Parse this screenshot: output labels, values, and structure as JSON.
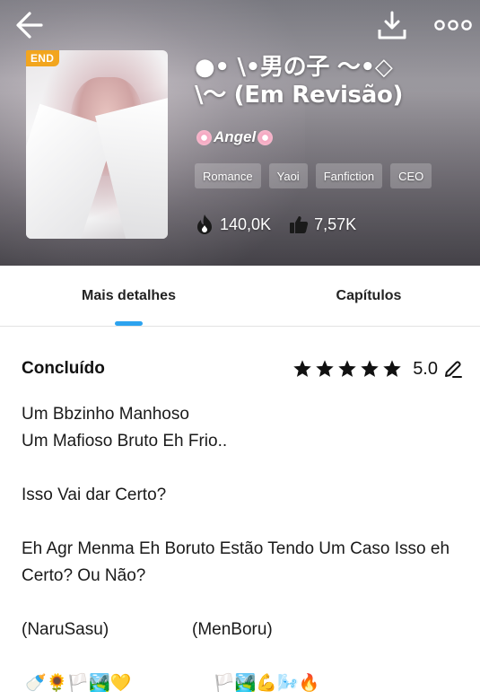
{
  "header": {
    "end_badge": "END",
    "title": "●• \\•男の子 〜•◇\n\\〜 (Em Revisão)",
    "author": "Angel",
    "tags": [
      "Romance",
      "Yaoi",
      "Fanfiction",
      "CEO"
    ],
    "views": "140,0K",
    "likes": "7,57K",
    "icons": {
      "back": "arrow-left-icon",
      "download": "download-icon",
      "more": "more-dots-icon",
      "views": "flame-icon",
      "likes": "thumbs-up-icon"
    }
  },
  "tabs": [
    {
      "label": "Mais detalhes",
      "active": true
    },
    {
      "label": "Capítulos",
      "active": false
    }
  ],
  "accent_color": "#2da3ef",
  "badge_color": "#f2a51e",
  "details": {
    "status": "Concluído",
    "rating_value": "5.0",
    "stars_filled": 5,
    "stars_total": 5,
    "description": {
      "line1": "Um Bbzinho Manhoso",
      "line2": "Um Mafioso Bruto Eh Frio..",
      "line3": "Isso Vai dar Certo?",
      "line4": "Eh Agr Menma Eh Boruto Estão Tendo Um Caso Isso eh Certo? Ou Não?",
      "pair1": "(NaruSasu)",
      "pair2": "(MenBoru)",
      "emojis1": "🍼🌻🏳️🏞️💛",
      "emojis2": "🏳️🏞️💪🌬️🔥"
    }
  }
}
